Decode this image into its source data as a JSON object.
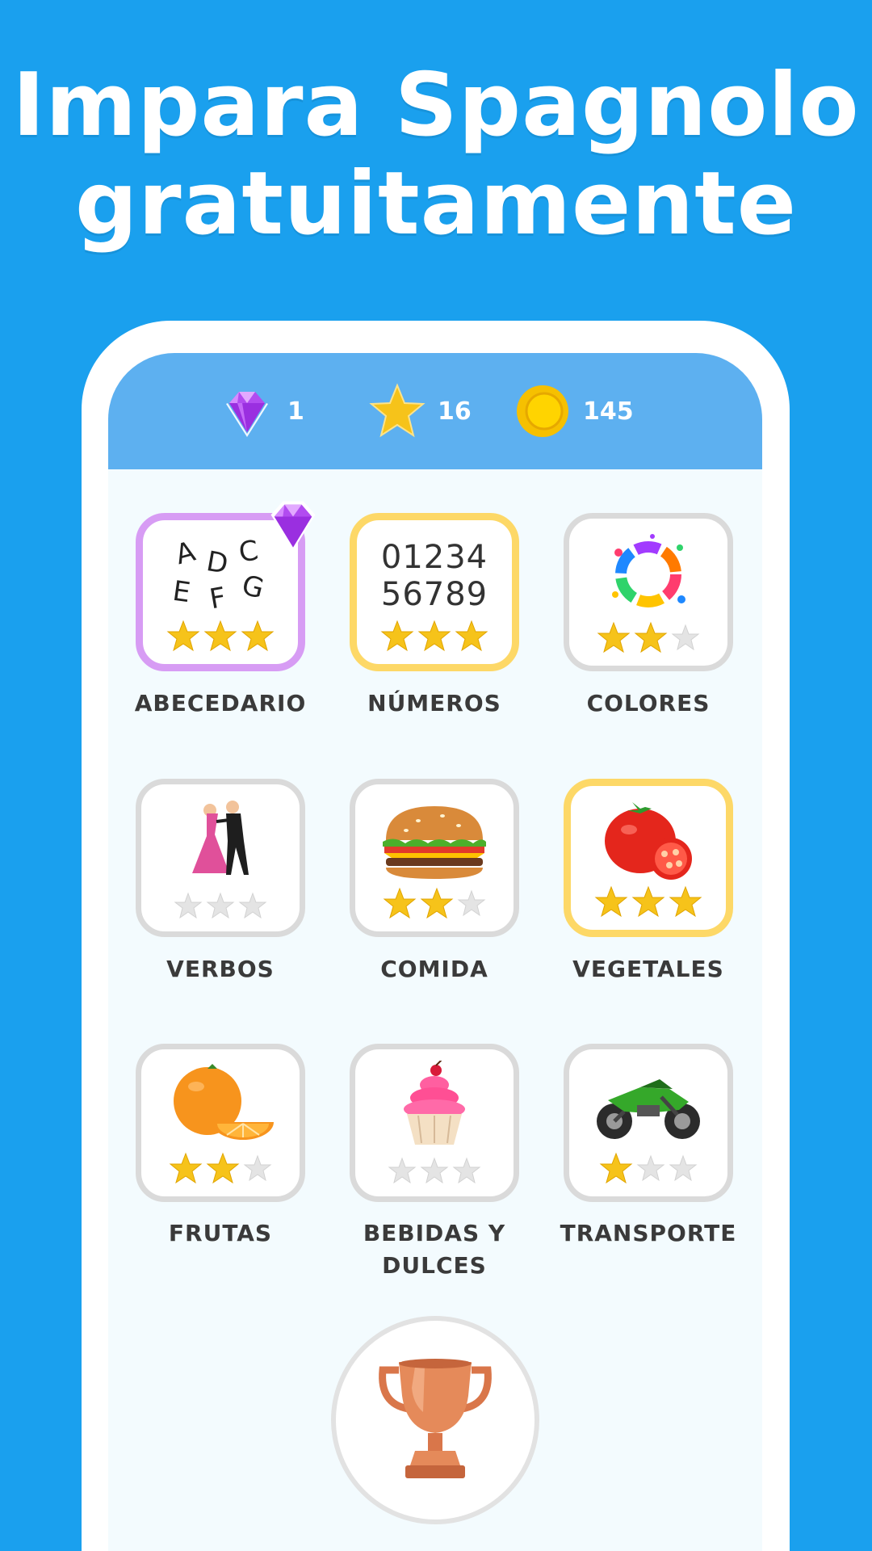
{
  "headline": {
    "line1": "Impara Spagnolo",
    "line2": "gratuitamente"
  },
  "stats": {
    "gems": "1",
    "stars": "16",
    "coins": "145"
  },
  "categories": [
    {
      "label": "ABECEDARIO",
      "icon": "alphabet-letters-icon",
      "stars": 3,
      "border": "purple",
      "letters": [
        "A",
        "D",
        "C",
        "E",
        "F",
        "G"
      ]
    },
    {
      "label": "NÚMEROS",
      "icon": "numbers-icon",
      "stars": 3,
      "border": "gold",
      "line1": "01234",
      "line2": "56789"
    },
    {
      "label": "COLORES",
      "icon": "paint-splash-icon",
      "stars": 2,
      "border": "grey"
    },
    {
      "label": "VERBOS",
      "icon": "dancing-couple-icon",
      "stars": 0,
      "border": "grey"
    },
    {
      "label": "COMIDA",
      "icon": "burger-icon",
      "stars": 2,
      "border": "grey"
    },
    {
      "label": "VEGETALES",
      "icon": "tomato-icon",
      "stars": 3,
      "border": "gold"
    },
    {
      "label": "FRUTAS",
      "icon": "orange-icon",
      "stars": 2,
      "border": "grey"
    },
    {
      "label": "BEBIDAS Y DULCES",
      "icon": "cupcake-icon",
      "stars": 0,
      "border": "grey"
    },
    {
      "label": "TRANSPORTE",
      "icon": "motorcycle-icon",
      "stars": 1,
      "border": "grey"
    }
  ],
  "colors": {
    "background": "#1aa0ee",
    "topbar": "#5db0f0",
    "gold_border": "#fdd867",
    "purple_border": "#d79cf4",
    "star": "#f6c31a"
  },
  "trophy_icon": "trophy-icon"
}
